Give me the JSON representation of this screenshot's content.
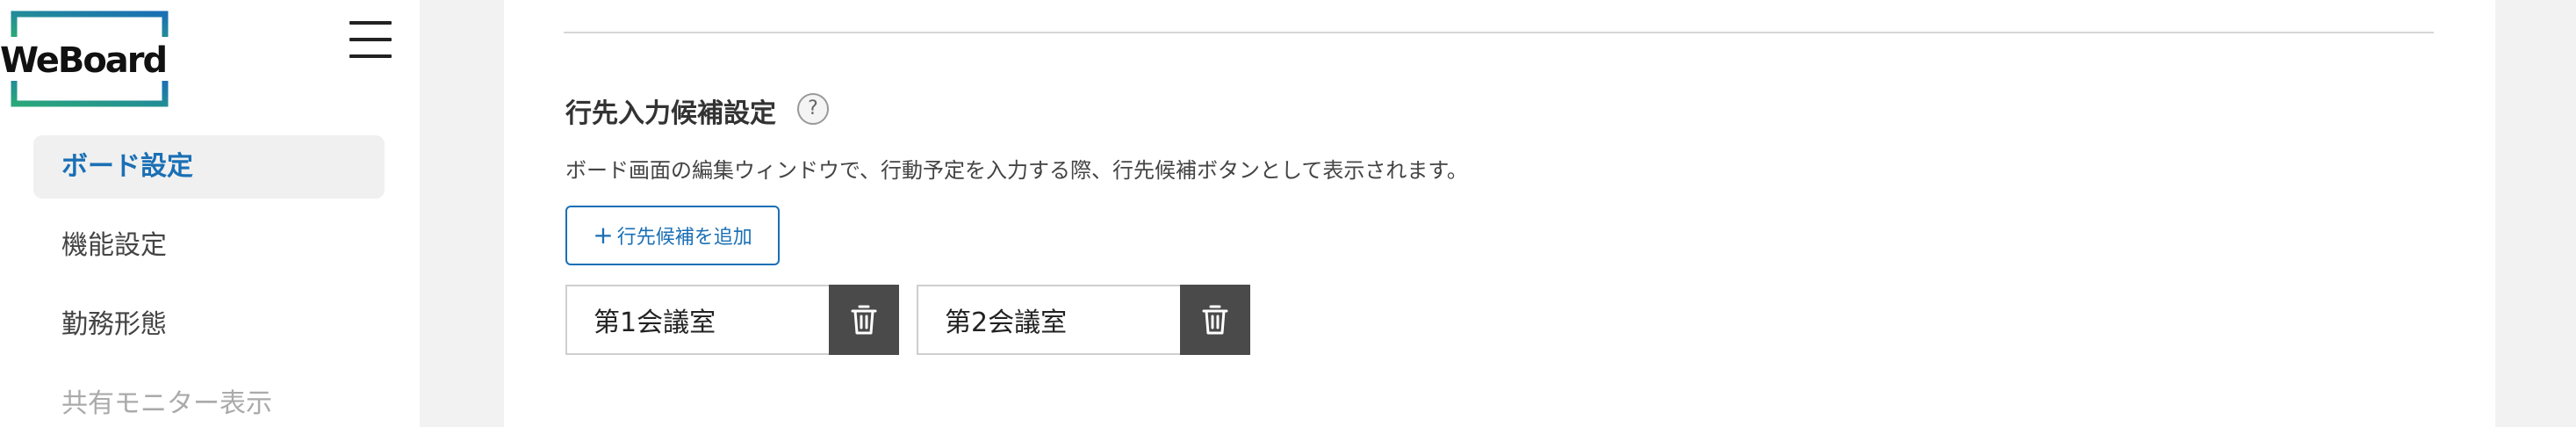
{
  "app": {
    "logo_text": "WeBoard"
  },
  "sidebar": {
    "items": [
      {
        "label": "ボード設定",
        "state": "active"
      },
      {
        "label": "機能設定",
        "state": "normal"
      },
      {
        "label": "勤務形態",
        "state": "normal"
      },
      {
        "label": "共有モニター表示",
        "state": "disabled"
      }
    ]
  },
  "section": {
    "title": "行先入力候補設定",
    "help_symbol": "?",
    "description": "ボード画面の編集ウィンドウで、行動予定を入力する際、行先候補ボタンとして表示されます。",
    "add_button_label": "行先候補を追加",
    "add_button_symbol": "+",
    "candidates": [
      {
        "value": "第1会議室"
      },
      {
        "value": "第2会議室"
      }
    ]
  },
  "colors": {
    "accent": "#1a6fb5",
    "logo_gradient_start": "#2aa87a",
    "logo_gradient_end": "#1a6fb5",
    "delete_button_bg": "#4a4a4a",
    "page_bg": "#f2f2f2"
  },
  "icons": {
    "menu": "hamburger-menu-icon",
    "help": "question-circle-icon",
    "delete": "trash-icon"
  }
}
